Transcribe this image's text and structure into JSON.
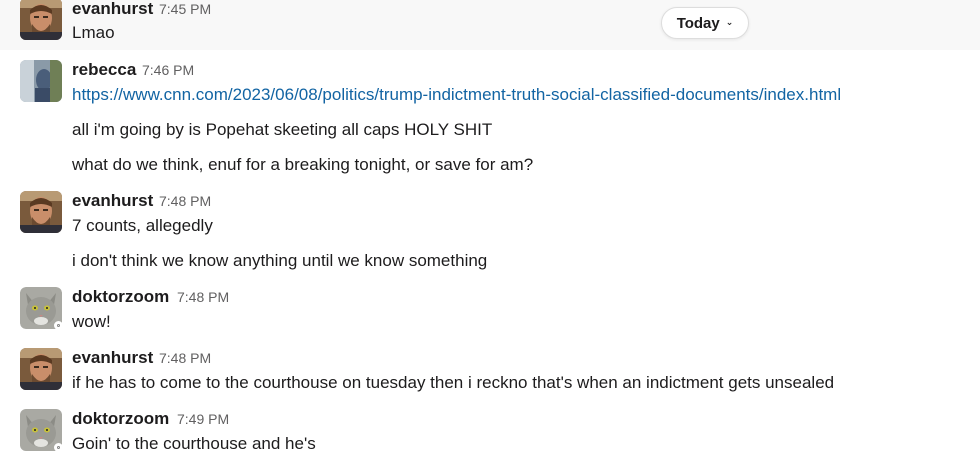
{
  "date_divider": {
    "label": "Today"
  },
  "messages": [
    {
      "author": "evanhurst",
      "time": "7:45 PM",
      "lines": [
        "Lmao"
      ]
    },
    {
      "author": "rebecca",
      "time": "7:46 PM",
      "link": "https://www.cnn.com/2023/06/08/politics/trump-indictment-truth-social-classified-documents/index.html",
      "lines": [
        "all i'm going by is Popehat skeeting all caps HOLY SHIT",
        "what do we think, enuf for a breaking tonight, or save for am?"
      ]
    },
    {
      "author": "evanhurst",
      "time": "7:48 PM",
      "lines": [
        "7 counts, allegedly",
        "i don't think we know anything until we know something"
      ]
    },
    {
      "author": "doktorzoom",
      "time": "7:48 PM",
      "lines": [
        "wow!"
      ]
    },
    {
      "author": "evanhurst",
      "time": "7:48 PM",
      "lines": [
        "if he has to come to the courthouse on tuesday then i reckno that's when an indictment gets unsealed"
      ]
    },
    {
      "author": "doktorzoom",
      "time": "7:49 PM",
      "lines": [
        "Goin' to the courthouse and he's"
      ]
    }
  ]
}
